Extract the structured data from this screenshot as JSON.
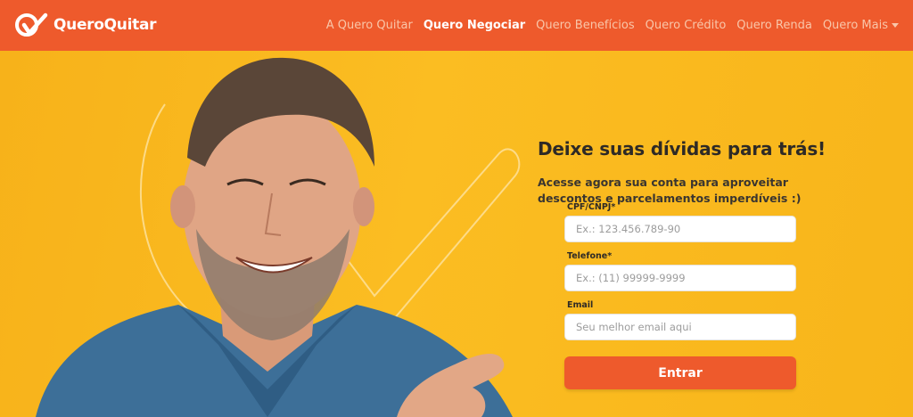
{
  "brand": {
    "name": "QueroQuitar",
    "logo_icon": "qq-check-logo-icon",
    "primary_color": "#ee5a2c",
    "hero_color": "#fbb81d"
  },
  "nav": {
    "items": [
      {
        "label": "A Quero Quitar",
        "active": false
      },
      {
        "label": "Quero Negociar",
        "active": true
      },
      {
        "label": "Quero Benefícios",
        "active": false
      },
      {
        "label": "Quero Crédito",
        "active": false
      },
      {
        "label": "Quero Renda",
        "active": false
      },
      {
        "label": "Quero Mais",
        "active": false,
        "dropdown": true
      }
    ]
  },
  "hero": {
    "image": "smiling-man-denim-shirt-pointing",
    "title": "Deixe suas dívidas para trás!",
    "subtitle": "Acesse agora sua conta para aproveitar descontos e parcelamentos imperdíveis :)"
  },
  "form": {
    "cpf": {
      "label": "CPF/CNPJ*",
      "placeholder": "Ex.: 123.456.789-90",
      "value": ""
    },
    "phone": {
      "label": "Telefone*",
      "placeholder": "Ex.: (11) 99999-9999",
      "value": ""
    },
    "email": {
      "label": "Email",
      "placeholder": "Seu melhor email aqui",
      "value": ""
    },
    "submit_label": "Entrar"
  }
}
